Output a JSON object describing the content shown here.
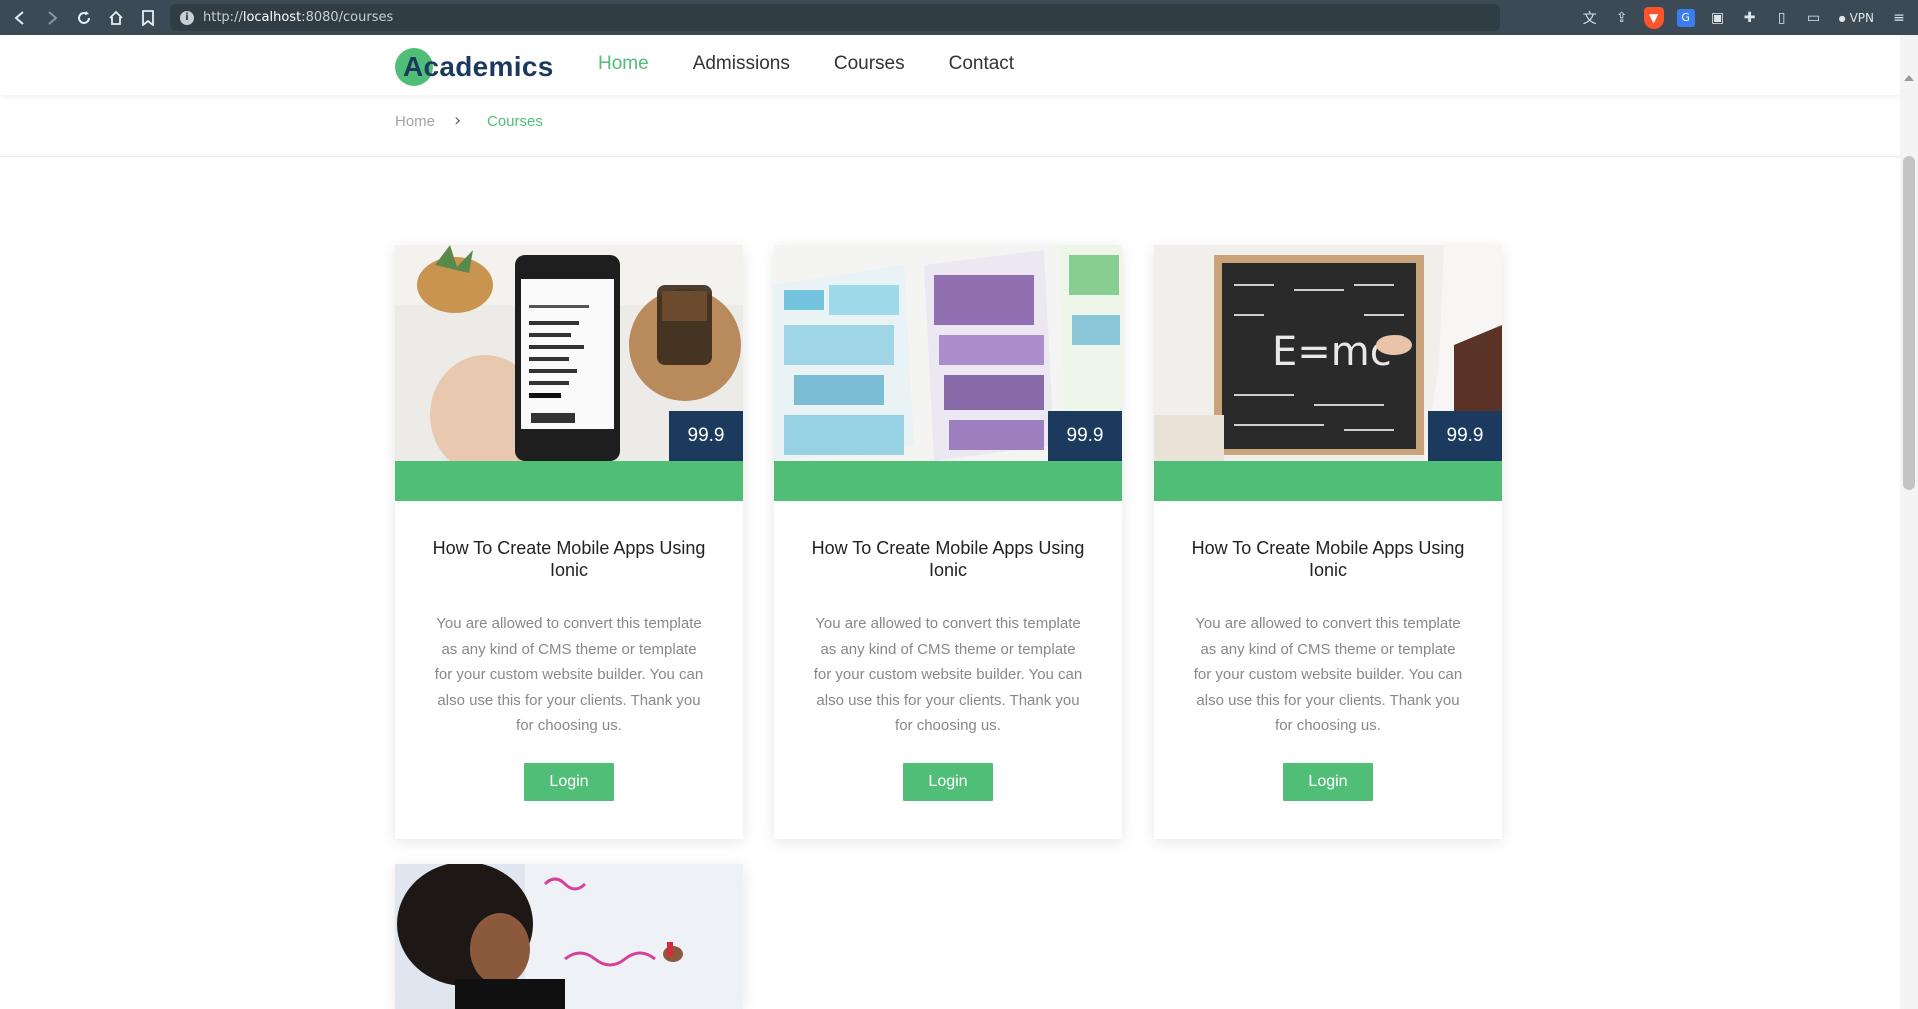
{
  "browser": {
    "url_prefix": "http://",
    "url_host": "localhost",
    "url_rest": ":8080/courses",
    "vpn_label": "VPN",
    "icons": [
      "back-icon",
      "forward-icon",
      "reload-icon",
      "home-icon",
      "bookmark-icon",
      "info-icon",
      "translate-icon",
      "share-icon",
      "brave-shield-icon",
      "google-translate-icon",
      "extension-icon",
      "puzzle-icon",
      "sidebar-icon",
      "wallet-icon",
      "menu-icon"
    ]
  },
  "header": {
    "logo_text": "Academics",
    "menu": [
      {
        "label": "Home",
        "active": true
      },
      {
        "label": "Admissions",
        "active": false
      },
      {
        "label": "Courses",
        "active": false
      },
      {
        "label": "Contact",
        "active": false
      }
    ]
  },
  "breadcrumb": {
    "home": "Home",
    "separator": "›",
    "current": "Courses"
  },
  "courses": [
    {
      "image": "phone-photo",
      "price": "99.9",
      "title": "How To Create Mobile Apps Using Ionic",
      "description": "You are allowed to convert this template as any kind of CMS theme or template for your custom website builder. You can also use this for your clients. Thank you for choosing us.",
      "button": "Login"
    },
    {
      "image": "wireframe-sketch",
      "price": "99.9",
      "title": "How To Create Mobile Apps Using Ionic",
      "description": "You are allowed to convert this template as any kind of CMS theme or template for your custom website builder. You can also use this for your clients. Thank you for choosing us.",
      "button": "Login"
    },
    {
      "image": "chalkboard-emc2",
      "price": "99.9",
      "title": "How To Create Mobile Apps Using Ionic",
      "description": "You are allowed to convert this template as any kind of CMS theme or template for your custom website builder. You can also use this for your clients. Thank you for choosing us.",
      "button": "Login"
    },
    {
      "image": "whiteboard-writing"
    }
  ],
  "colors": {
    "accent": "#51be78",
    "navy": "#1b3a5e",
    "chrome": "#3b4a54"
  }
}
